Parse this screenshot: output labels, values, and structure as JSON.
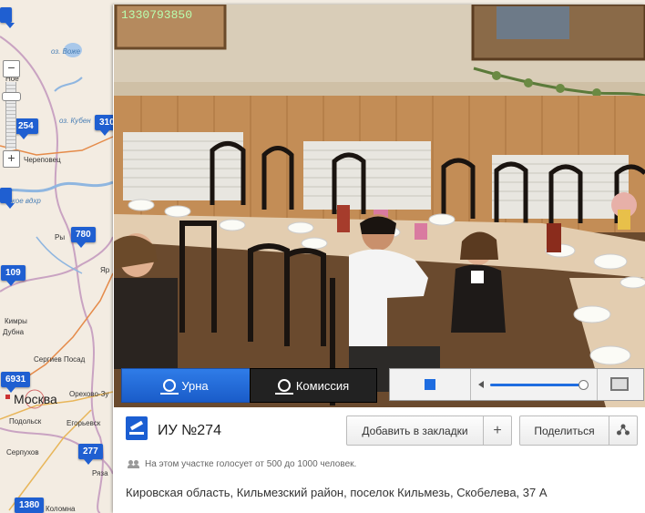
{
  "map": {
    "labels": {
      "oz_bozhe": "оз. Воже",
      "nozero": "Ное",
      "oz_kubenskoe": "оз. Кубен",
      "cherepovets": "Череповец",
      "vdkhr": "вское вдхр",
      "ry": "Ры",
      "ya": "Яр",
      "kimry": "Кимры",
      "dubna": "Дубна",
      "sergiev_posad": "Сергиев Посад",
      "moskva": "Москва",
      "orekhovo": "Орехово-Зу",
      "podolsk": "Подольск",
      "egorievsk": "Егорьевск",
      "serpukhov": "Серпухов",
      "ryaz": "Ряза",
      "kolomna": "Коломна"
    },
    "markers": {
      "m254": "254",
      "m310": "310",
      "m780": "780",
      "m109": "109",
      "m6931": "6931",
      "m277": "277",
      "m1380": "1380"
    },
    "zoom_in": "+",
    "zoom_out": "−"
  },
  "video": {
    "timestamp": "1330793850",
    "btn_urna": "Урна",
    "btn_komissia": "Комиссия"
  },
  "info": {
    "title": "ИУ №274",
    "bookmark_label": "Добавить в закладки",
    "bookmark_plus": "+",
    "share_label": "Поделиться",
    "voters_text": "На этом участке голосует от 500 до 1000 человек.",
    "address": "Кировская область, Кильмезский район, поселок Кильмезь, Скобелева, 37 А"
  },
  "colors": {
    "accent": "#1f5fd1",
    "map_bg": "#f3ece2",
    "wall": "#c79a64",
    "table": "#e3cdb0"
  }
}
